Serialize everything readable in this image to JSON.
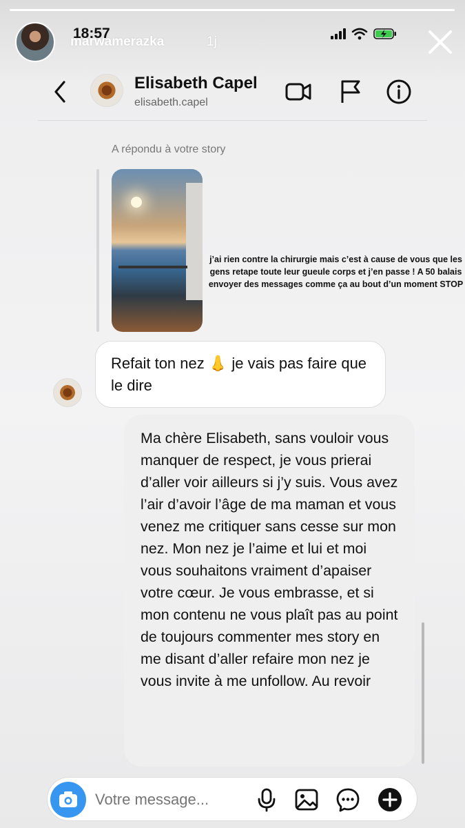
{
  "story": {
    "username": "marwamerazka",
    "time_ago": "1j",
    "progress": 1.0
  },
  "status_bar": {
    "time": "18:57"
  },
  "chat_header": {
    "name": "Elisabeth Capel",
    "username": "elisabeth.capel",
    "icons": [
      "back-icon",
      "video-call-icon",
      "flag-icon",
      "info-icon"
    ]
  },
  "thread": {
    "reply_label": "A répondu à votre story",
    "story_caption": "j’ai rien contre la chirurgie mais c’est à cause de vous que les gens retape toute leur gueule corps et j’en passe ! A 50 balais envoyer des messages comme ça au bout d’un moment STOP",
    "incoming_message": "Refait ton nez 👃 je vais pas faire que le dire",
    "outgoing_message": "Ma chère Elisabeth, sans vouloir vous manquer de respect, je vous prierai d’aller voir ailleurs si j’y suis. Vous avez l’air d’avoir l’âge de ma maman et vous venez me critiquer sans cesse sur mon nez. Mon nez je l’aime et lui et moi vous souhaitons vraiment d’apaiser votre cœur. Je vous embrasse, et si mon contenu ne vous plaît pas au point de toujours commenter mes story en me disant d’aller refaire mon nez je vous invite à me unfollow. Au revoir"
  },
  "composer": {
    "placeholder": "Votre message...",
    "icons": [
      "camera-icon",
      "microphone-icon",
      "gallery-icon",
      "sticker-icon",
      "plus-icon"
    ]
  },
  "colors": {
    "accent": "#3797f0",
    "outgoing_bubble": "#efefef",
    "incoming_bubble": "#ffffff"
  }
}
